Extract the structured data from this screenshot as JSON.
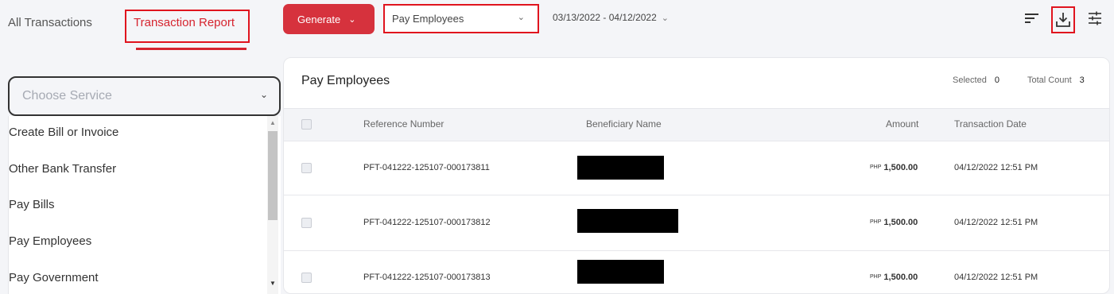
{
  "nav": {
    "all_transactions": "All Transactions",
    "transaction_report": "Transaction Report"
  },
  "toolbar": {
    "generate_label": "Generate",
    "service_selected": "Pay Employees",
    "date_range": "03/13/2022 - 04/12/2022",
    "icons": [
      "sort-icon",
      "download-icon",
      "filter-settings-icon"
    ]
  },
  "service_dropdown": {
    "placeholder": "Choose Service",
    "options": [
      "Create Bill or Invoice",
      "Other Bank Transfer",
      "Pay Bills",
      "Pay Employees",
      "Pay Government"
    ]
  },
  "report": {
    "title": "Pay Employees",
    "selected_label": "Selected",
    "selected_count": "0",
    "total_label": "Total Count",
    "total_count": "3",
    "columns": [
      "Reference Number",
      "Beneficiary Name",
      "Amount",
      "Transaction Date"
    ],
    "rows": [
      {
        "reference": "PFT-041222-125107-000173811",
        "currency": "PHP",
        "amount": "1,500.00",
        "date": "04/12/2022 12:51 PM"
      },
      {
        "reference": "PFT-041222-125107-000173812",
        "currency": "PHP",
        "amount": "1,500.00",
        "date": "04/12/2022 12:51 PM"
      },
      {
        "reference": "PFT-041222-125107-000173813",
        "currency": "PHP",
        "amount": "1,500.00",
        "date": "04/12/2022 12:51 PM"
      }
    ]
  },
  "colors": {
    "accent": "#d6323d",
    "highlight_outline": "#e0141e"
  }
}
